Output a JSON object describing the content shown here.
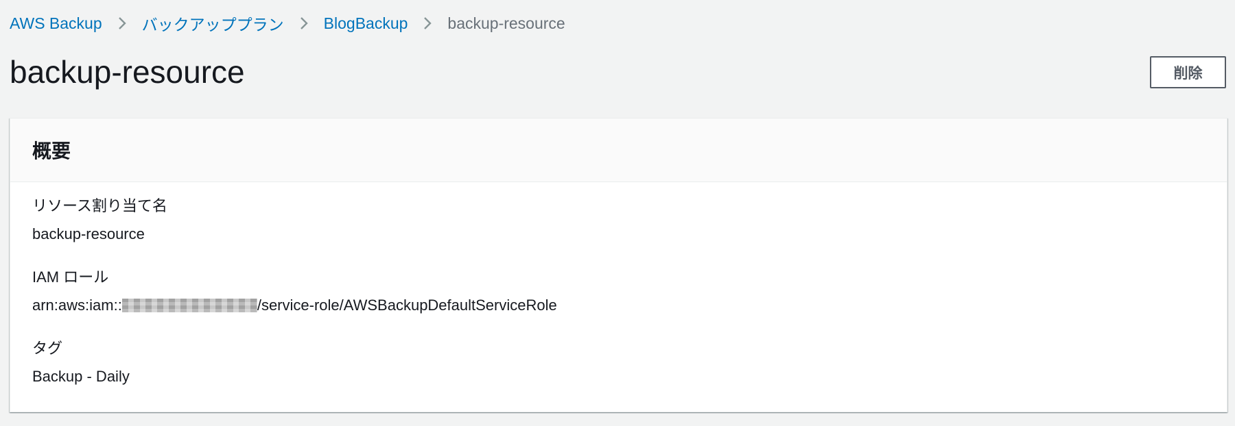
{
  "breadcrumb": {
    "items": [
      {
        "label": "AWS Backup"
      },
      {
        "label": "バックアッププラン"
      },
      {
        "label": "BlogBackup"
      }
    ],
    "current": "backup-resource",
    "separator_icon": "chevron-right-icon"
  },
  "header": {
    "title": "backup-resource",
    "delete_label": "削除"
  },
  "summary": {
    "title": "概要",
    "fields": [
      {
        "label": "リソース割り当て名",
        "value": "backup-resource"
      },
      {
        "label": "IAM ロール",
        "value_prefix": "arn:aws:iam::",
        "value_suffix": "/service-role/AWSBackupDefaultServiceRole"
      },
      {
        "label": "タグ",
        "value": "Backup - Daily"
      }
    ]
  },
  "colors": {
    "background": "#f2f3f3",
    "link": "#0073bb",
    "text": "#16191f",
    "muted": "#687078",
    "button_border": "#545b64"
  }
}
